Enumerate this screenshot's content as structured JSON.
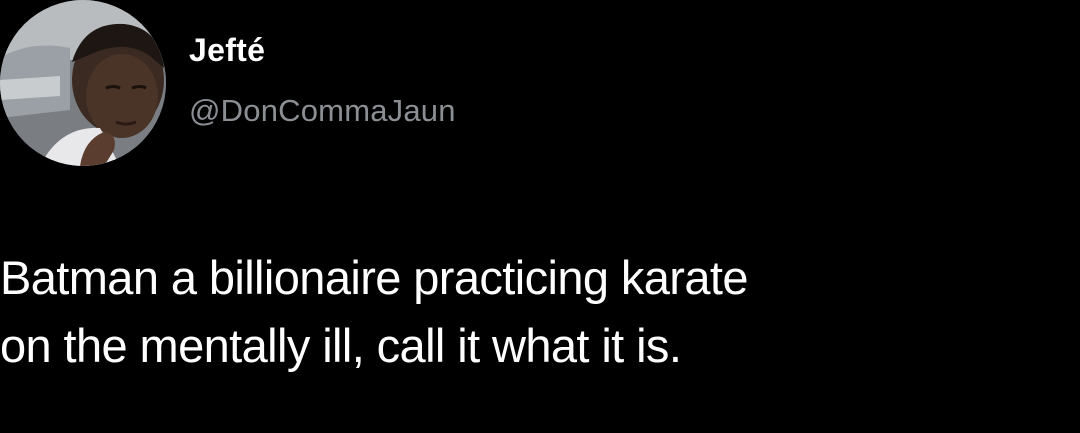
{
  "tweet": {
    "author": {
      "display_name": "Jefté",
      "handle": "@DonCommaJaun",
      "avatar_icon": "profile-photo"
    },
    "text_lines": [
      "Batman a billionaire practicing karate",
      "on the mentally ill, call it what it is."
    ]
  },
  "colors": {
    "background": "#000000",
    "primary_text": "#ffffff",
    "secondary_text": "#8b8f94"
  }
}
